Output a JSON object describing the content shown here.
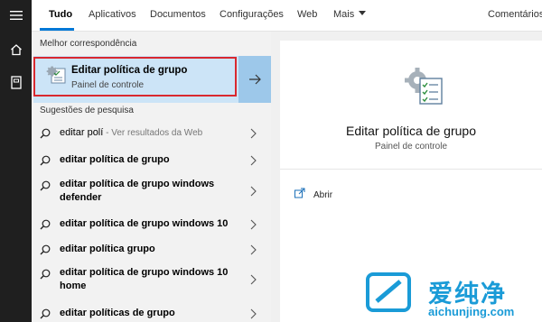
{
  "nav": {
    "tabs": [
      {
        "label": "Tudo"
      },
      {
        "label": "Aplicativos"
      },
      {
        "label": "Documentos"
      },
      {
        "label": "Configurações"
      },
      {
        "label": "Web"
      },
      {
        "label": "Mais"
      }
    ],
    "comments": "Comentários"
  },
  "best_match": {
    "section_label": "Melhor correspondência",
    "title": "Editar política de grupo",
    "subtitle": "Painel de controle"
  },
  "suggestions": {
    "section_label": "Sugestões de pesquisa",
    "items": [
      {
        "text": "editar polí",
        "hint": " - Ver resultados da Web"
      },
      {
        "text": "editar política de grupo"
      },
      {
        "text": "editar política de grupo windows defender"
      },
      {
        "text": "editar política de grupo windows 10"
      },
      {
        "text": "editar política grupo"
      },
      {
        "text": "editar política de grupo windows 10 home"
      },
      {
        "text": "editar políticas de grupo"
      }
    ]
  },
  "preview": {
    "title": "Editar política de grupo",
    "subtitle": "Painel de controle",
    "action_open": "Abrir"
  },
  "watermark": {
    "brand_cn": "爱纯净",
    "url": "aichunjing.com"
  },
  "colors": {
    "accent": "#0078d7",
    "highlight_bg": "#cce4f7",
    "highlight_border": "#d9282f",
    "taskbar": "#1f1f1f"
  }
}
